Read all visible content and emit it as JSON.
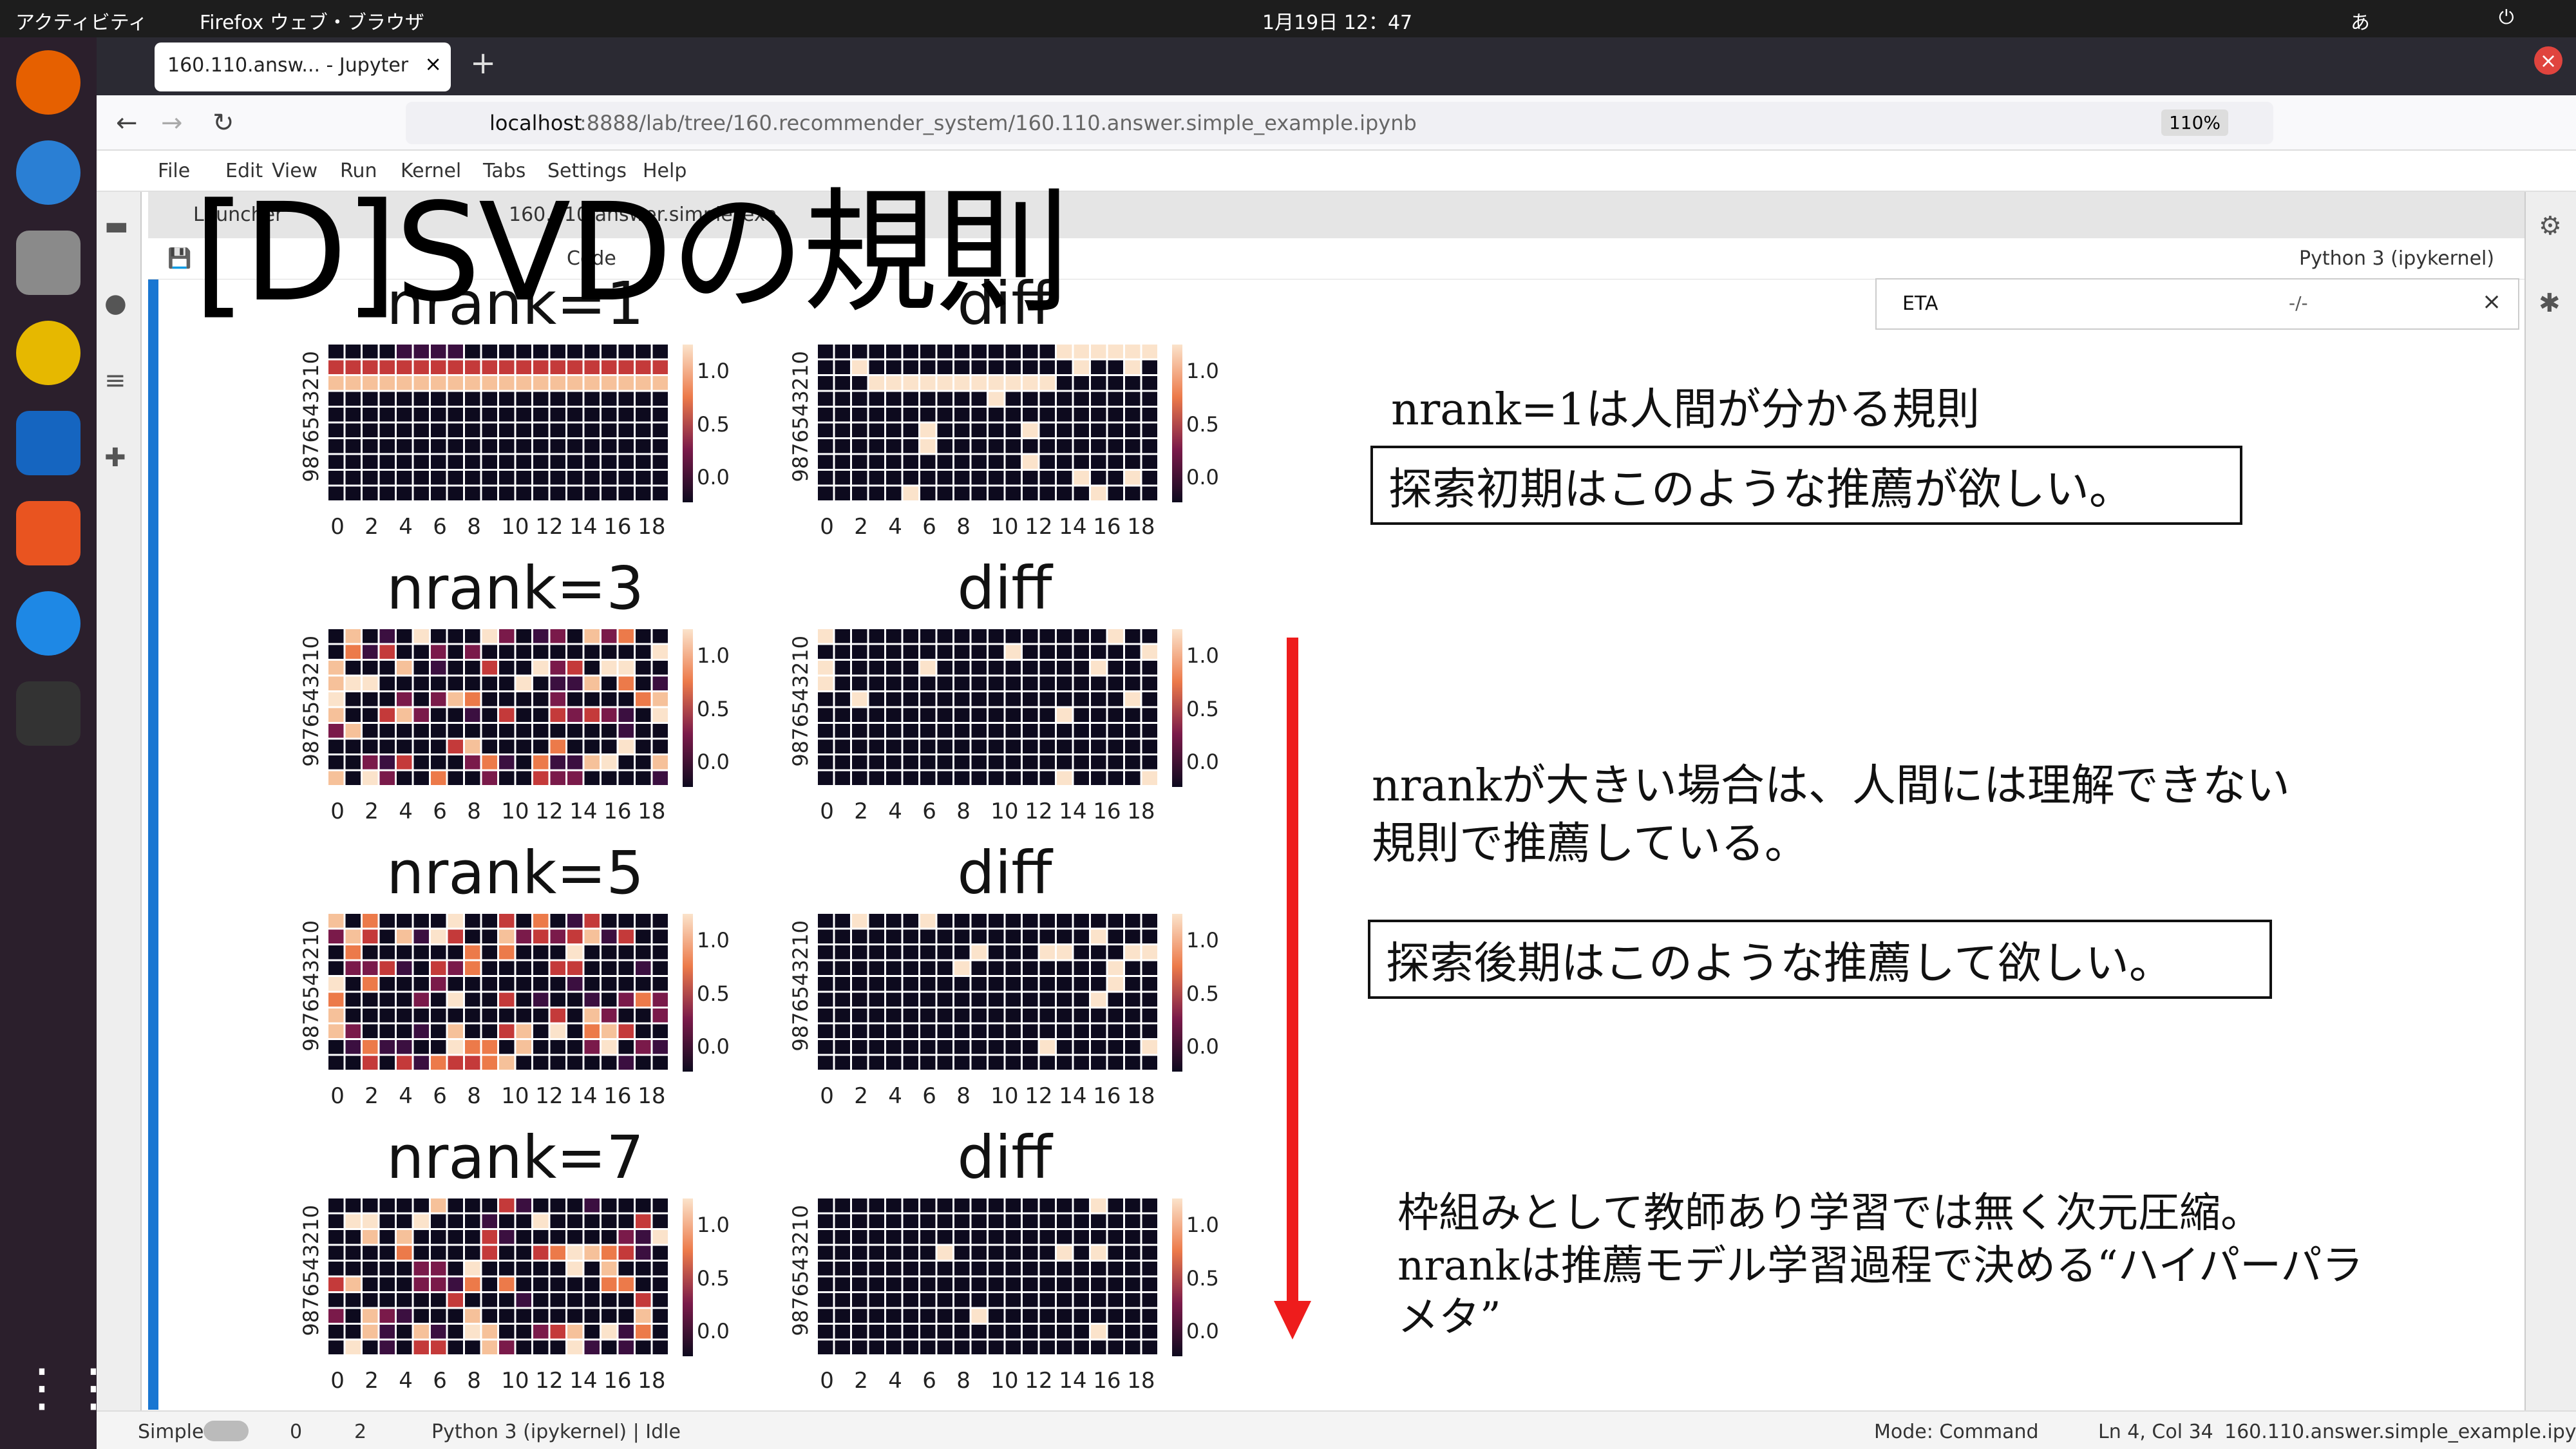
{
  "system": {
    "activities": "アクティビティ",
    "app_menu": "Firefox ウェブ・ブラウザ",
    "clock": "1月19日 12：47",
    "ime": "あ"
  },
  "browser": {
    "tab_title": "160.110.answ... - Jupyter",
    "url_host": "localhost",
    "url_path": ":8888/lab/tree/160.recommender_system/160.110.answer.simple_example.ipynb",
    "zoom": "110%"
  },
  "jupyter": {
    "menu": [
      "File",
      "Edit",
      "View",
      "Run",
      "Kernel",
      "Tabs",
      "Settings",
      "Help"
    ],
    "tabs": [
      "Launcher",
      "160.110.answer.simple_exa"
    ],
    "celltype": "Code",
    "kernel": "Python 3 (ipykernel)",
    "find_value": "ETA",
    "find_count": "-/-"
  },
  "slide_title": "[D]SVDの規則",
  "annotations": {
    "a1": "nrank=1は人間が分かる規則",
    "a2": "探索初期はこのような推薦が欲しい。",
    "a3_l1": "nrankが大きい場合は、人間には理解できない",
    "a3_l2": "規則で推薦している。",
    "a4": "探索後期はこのような推薦して欲しい。",
    "a5_l1": "枠組みとして教師あり学習では無く次元圧縮。",
    "a5_l2": "nrankは推薦モデル学習過程で決める“ハイパーパラ",
    "a5_l3": "メタ”"
  },
  "status": {
    "mode_label": "Simple",
    "c0": "0",
    "c2": "2",
    "kernel_state": "Python 3 (ipykernel) | Idle",
    "mode": "Mode: Command",
    "pos": "Ln 4, Col 34",
    "file": "160.110.answer.simple_example.ipynb"
  },
  "chart_data": [
    {
      "type": "heatmap",
      "title": "nrank=1",
      "x_ticks": [
        "0",
        "2",
        "4",
        "6",
        "8",
        "10",
        "12",
        "14",
        "16",
        "18"
      ],
      "y_ticks": [
        "9",
        "8",
        "7",
        "6",
        "5",
        "4",
        "3",
        "2",
        "1",
        "0"
      ],
      "colorbar_ticks": [
        "1.0",
        "0.5",
        "0.0"
      ],
      "seed": 1
    },
    {
      "type": "heatmap",
      "title": "diff",
      "x_ticks": [
        "0",
        "2",
        "4",
        "6",
        "8",
        "10",
        "12",
        "14",
        "16",
        "18"
      ],
      "y_ticks": [
        "9",
        "8",
        "7",
        "6",
        "5",
        "4",
        "3",
        "2",
        "1",
        "0"
      ],
      "colorbar_ticks": [
        "1.0",
        "0.5",
        "0.0"
      ],
      "seed": 2
    },
    {
      "type": "heatmap",
      "title": "nrank=3",
      "x_ticks": [
        "0",
        "2",
        "4",
        "6",
        "8",
        "10",
        "12",
        "14",
        "16",
        "18"
      ],
      "y_ticks": [
        "9",
        "8",
        "7",
        "6",
        "5",
        "4",
        "3",
        "2",
        "1",
        "0"
      ],
      "colorbar_ticks": [
        "1.0",
        "0.5",
        "0.0"
      ],
      "seed": 3
    },
    {
      "type": "heatmap",
      "title": "diff",
      "x_ticks": [
        "0",
        "2",
        "4",
        "6",
        "8",
        "10",
        "12",
        "14",
        "16",
        "18"
      ],
      "y_ticks": [
        "9",
        "8",
        "7",
        "6",
        "5",
        "4",
        "3",
        "2",
        "1",
        "0"
      ],
      "colorbar_ticks": [
        "1.0",
        "0.5",
        "0.0"
      ],
      "seed": 4
    },
    {
      "type": "heatmap",
      "title": "nrank=5",
      "x_ticks": [
        "0",
        "2",
        "4",
        "6",
        "8",
        "10",
        "12",
        "14",
        "16",
        "18"
      ],
      "y_ticks": [
        "9",
        "8",
        "7",
        "6",
        "5",
        "4",
        "3",
        "2",
        "1",
        "0"
      ],
      "colorbar_ticks": [
        "1.0",
        "0.5",
        "0.0"
      ],
      "seed": 5
    },
    {
      "type": "heatmap",
      "title": "diff",
      "x_ticks": [
        "0",
        "2",
        "4",
        "6",
        "8",
        "10",
        "12",
        "14",
        "16",
        "18"
      ],
      "y_ticks": [
        "9",
        "8",
        "7",
        "6",
        "5",
        "4",
        "3",
        "2",
        "1",
        "0"
      ],
      "colorbar_ticks": [
        "1.0",
        "0.5",
        "0.0"
      ],
      "seed": 6
    },
    {
      "type": "heatmap",
      "title": "nrank=7",
      "x_ticks": [
        "0",
        "2",
        "4",
        "6",
        "8",
        "10",
        "12",
        "14",
        "16",
        "18"
      ],
      "y_ticks": [
        "9",
        "8",
        "7",
        "6",
        "5",
        "4",
        "3",
        "2",
        "1",
        "0"
      ],
      "colorbar_ticks": [
        "1.0",
        "0.5",
        "0.0"
      ],
      "seed": 7
    },
    {
      "type": "heatmap",
      "title": "diff",
      "x_ticks": [
        "0",
        "2",
        "4",
        "6",
        "8",
        "10",
        "12",
        "14",
        "16",
        "18"
      ],
      "y_ticks": [
        "9",
        "8",
        "7",
        "6",
        "5",
        "4",
        "3",
        "2",
        "1",
        "0"
      ],
      "colorbar_ticks": [
        "1.0",
        "0.5",
        "0.0"
      ],
      "seed": 8
    }
  ]
}
